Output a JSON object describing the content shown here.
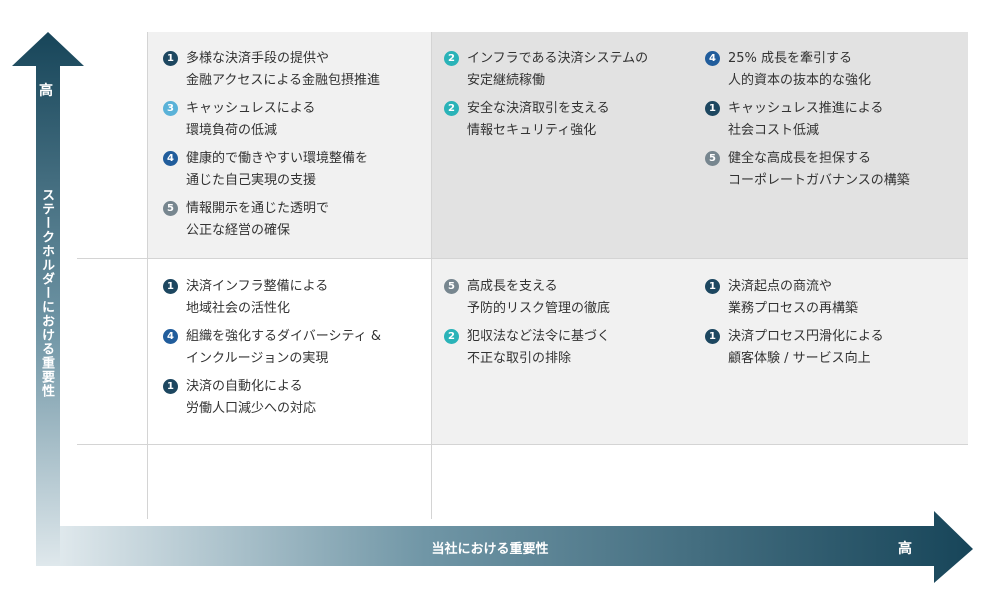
{
  "axes": {
    "y_title": "ステークホルダーにおける重要性",
    "y_high": "高",
    "x_title": "当社における重要性",
    "x_high": "高"
  },
  "colors": {
    "1": "#1d4760",
    "2": "#2ab3b8",
    "3": "#5ab2d8",
    "4": "#215d9c",
    "5": "#77868f"
  },
  "cells": {
    "top_left": [
      {
        "num": "1",
        "text": "多様な決済手段の提供や\n金融アクセスによる金融包摂推進"
      },
      {
        "num": "3",
        "text": "キャッシュレスによる\n環境負荷の低減"
      },
      {
        "num": "4",
        "text": "健康的で働きやすい環境整備を\n通じた自己実現の支援"
      },
      {
        "num": "5",
        "text": "情報開示を通じた透明で\n公正な経営の確保"
      }
    ],
    "top_mid": [
      {
        "num": "2",
        "text": "インフラである決済システムの\n安定継続稼働"
      },
      {
        "num": "2",
        "text": "安全な決済取引を支える\n情報セキュリティ強化"
      }
    ],
    "top_right": [
      {
        "num": "4",
        "text": "25% 成長を牽引する\n人的資本の抜本的な強化"
      },
      {
        "num": "1",
        "text": "キャッシュレス推進による\n社会コスト低減"
      },
      {
        "num": "5",
        "text": "健全な高成長を担保する\nコーポレートガバナンスの構築"
      }
    ],
    "mid_left": [
      {
        "num": "1",
        "text": "決済インフラ整備による\n地域社会の活性化"
      },
      {
        "num": "4",
        "text": "組織を強化するダイバーシティ &\nインクルージョンの実現"
      },
      {
        "num": "1",
        "text": "決済の自動化による\n労働人口減少への対応"
      }
    ],
    "mid_mid": [
      {
        "num": "5",
        "text": "高成長を支える\n予防的リスク管理の徹底"
      },
      {
        "num": "2",
        "text": "犯収法など法令に基づく\n不正な取引の排除"
      }
    ],
    "mid_right": [
      {
        "num": "1",
        "text": "決済起点の商流や\n業務プロセスの再構築"
      },
      {
        "num": "1",
        "text": "決済プロセス円滑化による\n顧客体験 / サービス向上"
      }
    ]
  }
}
